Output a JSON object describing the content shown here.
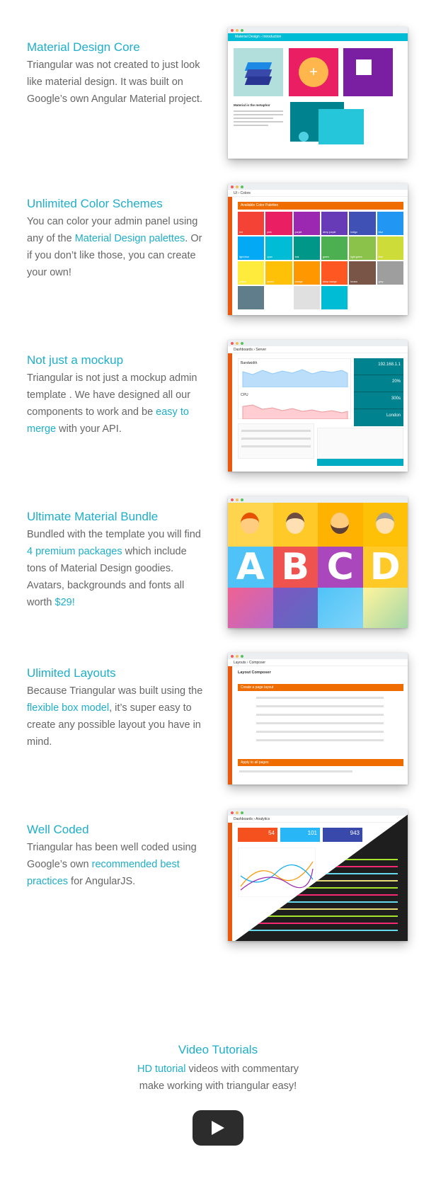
{
  "sections": [
    {
      "title": "Material Design Core",
      "paragraph": [
        {
          "text": "Triangular was not created to just look like material design. It was built on Google’s own Angular Material project.",
          "link": false
        }
      ],
      "screenshot": {
        "topbar": "Material Design  ›  Introduction",
        "card_title": "Material is the metaphor"
      }
    },
    {
      "title": "Unlimited Color Schemes",
      "paragraph": [
        {
          "text": "You can color your admin panel using any of the ",
          "link": false
        },
        {
          "text": "Material Design palettes",
          "link": true
        },
        {
          "text": ". Or if you don’t like those, you can create your own!",
          "link": false
        }
      ],
      "screenshot": {
        "topbar": "UI  ›  Colors",
        "panel_title": "Available Color Palettes",
        "swatch_colors": [
          "#f44336",
          "#e91e63",
          "#9c27b0",
          "#673ab7",
          "#3f51b5",
          "#2196f3",
          "#03a9f4",
          "#00bcd4",
          "#009688",
          "#4caf50",
          "#8bc34a",
          "#cddc39",
          "#ffeb3b",
          "#ffc107",
          "#ff9800",
          "#ff5722",
          "#795548",
          "#9e9e9e",
          "#607d8b",
          "#ffffff",
          "#e0e0e0",
          "#00bcd4"
        ],
        "swatch_labels": [
          "red",
          "pink",
          "purple",
          "deep purple",
          "indigo",
          "blue",
          "light blue",
          "cyan",
          "teal",
          "green",
          "light green",
          "lime",
          "yellow",
          "amber",
          "orange",
          "deep orange",
          "brown",
          "grey",
          "",
          "",
          "",
          ""
        ]
      }
    },
    {
      "title": "Not just a mockup",
      "paragraph": [
        {
          "text": "Triangular is not just a mockup admin template . We have designed all our components to work and be ",
          "link": false
        },
        {
          "text": "easy to merge",
          "link": true
        },
        {
          "text": " with your API.",
          "link": false
        }
      ],
      "screenshot": {
        "topbar": "Dashboards  ›  Server",
        "chart1": "Bandwidth",
        "chart2": "CPU",
        "stats": [
          "192.168.1.1",
          "20%",
          "300s",
          "London"
        ]
      }
    },
    {
      "title": "Ultimate Material Bundle",
      "paragraph": [
        {
          "text": "Bundled with the template you will find ",
          "link": false
        },
        {
          "text": "4 premium packages",
          "link": true
        },
        {
          "text": " which include tons of Material Design goodies. Avatars, backgrounds and fonts all worth ",
          "link": false
        },
        {
          "text": "$29!",
          "link": true
        }
      ],
      "screenshot": {
        "letters": [
          "A",
          "B",
          "C",
          "D"
        ]
      }
    },
    {
      "title": "Ulimited Layouts",
      "paragraph": [
        {
          "text": "Because Triangular was built using the ",
          "link": false
        },
        {
          "text": "flexible box model",
          "link": true
        },
        {
          "text": ", it’s super easy to create any possible layout you have in mind.",
          "link": false
        }
      ],
      "screenshot": {
        "topbar": "Layouts  ›  Composer",
        "card_title": "Layout Composer",
        "bar1": "Create a page layout",
        "bar2": "Apply to all pages"
      }
    },
    {
      "title": "Well Coded",
      "paragraph": [
        {
          "text": "Triangular has been well coded using Google’s own ",
          "link": false
        },
        {
          "text": "recommended best practices",
          "link": true
        },
        {
          "text": " for AngularJS.",
          "link": false
        }
      ],
      "screenshot": {
        "topbar": "Dashboards  ›  Analytics",
        "tiles": [
          "54",
          "101",
          "943"
        ]
      }
    }
  ],
  "video": {
    "title": "Video Tutorials",
    "paragraph": [
      {
        "text": "HD tutorial",
        "link": true
      },
      {
        "text": " videos with commentary make working with triangular easy!",
        "link": false
      }
    ]
  }
}
